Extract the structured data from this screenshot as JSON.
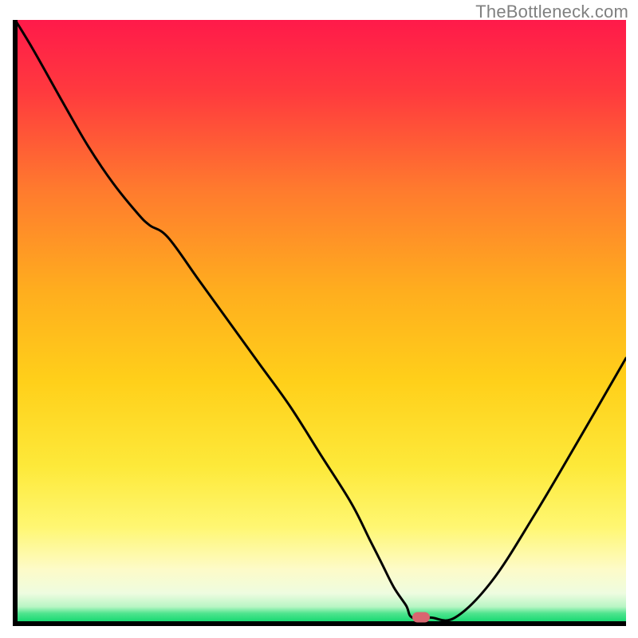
{
  "watermark": "TheBottleneck.com",
  "colors": {
    "gradient_top": "#ff1a4a",
    "gradient_mid_upper": "#ff7a2e",
    "gradient_mid": "#ffd01a",
    "gradient_mid_lower": "#fff060",
    "gradient_pale": "#fdfbc8",
    "gradient_green": "#09d76a",
    "axis": "#000000",
    "curve": "#000000",
    "marker": "#d96670"
  },
  "chart_data": {
    "type": "line",
    "title": "",
    "xlabel": "",
    "ylabel": "",
    "xlim": [
      0,
      100
    ],
    "ylim": [
      0,
      100
    ],
    "series": [
      {
        "name": "bottleneck-curve",
        "x": [
          0,
          3,
          8,
          12,
          16,
          20,
          22,
          25,
          30,
          35,
          40,
          45,
          50,
          55,
          58,
          60,
          62,
          64,
          65,
          68,
          72,
          78,
          85,
          92,
          100
        ],
        "values": [
          100,
          95,
          86,
          79,
          73,
          68,
          66,
          64,
          57,
          50,
          43,
          36,
          28,
          20,
          14,
          10,
          6,
          3,
          1,
          1,
          1,
          7,
          18,
          30,
          44
        ]
      }
    ],
    "marker": {
      "x": 66.5,
      "y": 1
    },
    "annotations": []
  }
}
